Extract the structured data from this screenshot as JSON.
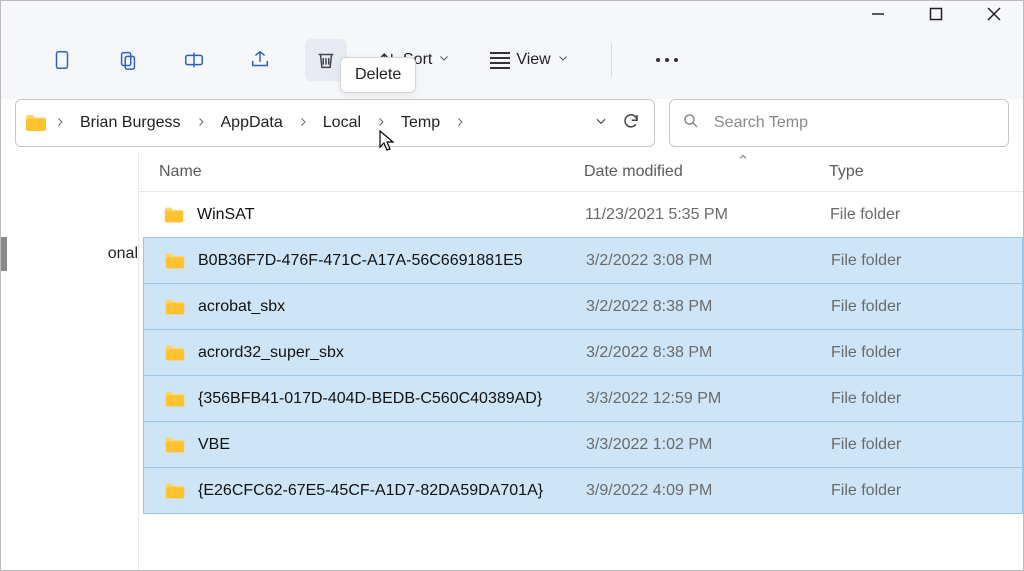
{
  "tooltip": {
    "delete": "Delete"
  },
  "toolbar": {
    "sort": "Sort",
    "view": "View"
  },
  "breadcrumbs": [
    "Brian Burgess",
    "AppData",
    "Local",
    "Temp"
  ],
  "search": {
    "placeholder": "Search Temp"
  },
  "sidebar": {
    "items": [
      "onal"
    ]
  },
  "columns": {
    "name": "Name",
    "date": "Date modified",
    "type": "Type"
  },
  "files": [
    {
      "name": "WinSAT",
      "date": "11/23/2021 5:35 PM",
      "type": "File folder",
      "selected": false
    },
    {
      "name": "B0B36F7D-476F-471C-A17A-56C6691881E5",
      "date": "3/2/2022 3:08 PM",
      "type": "File folder",
      "selected": true
    },
    {
      "name": "acrobat_sbx",
      "date": "3/2/2022 8:38 PM",
      "type": "File folder",
      "selected": true
    },
    {
      "name": "acrord32_super_sbx",
      "date": "3/2/2022 8:38 PM",
      "type": "File folder",
      "selected": true
    },
    {
      "name": "{356BFB41-017D-404D-BEDB-C560C40389AD}",
      "date": "3/3/2022 12:59 PM",
      "type": "File folder",
      "selected": true
    },
    {
      "name": "VBE",
      "date": "3/3/2022 1:02 PM",
      "type": "File folder",
      "selected": true
    },
    {
      "name": "{E26CFC62-67E5-45CF-A1D7-82DA59DA701A}",
      "date": "3/9/2022 4:09 PM",
      "type": "File folder",
      "selected": true
    }
  ]
}
